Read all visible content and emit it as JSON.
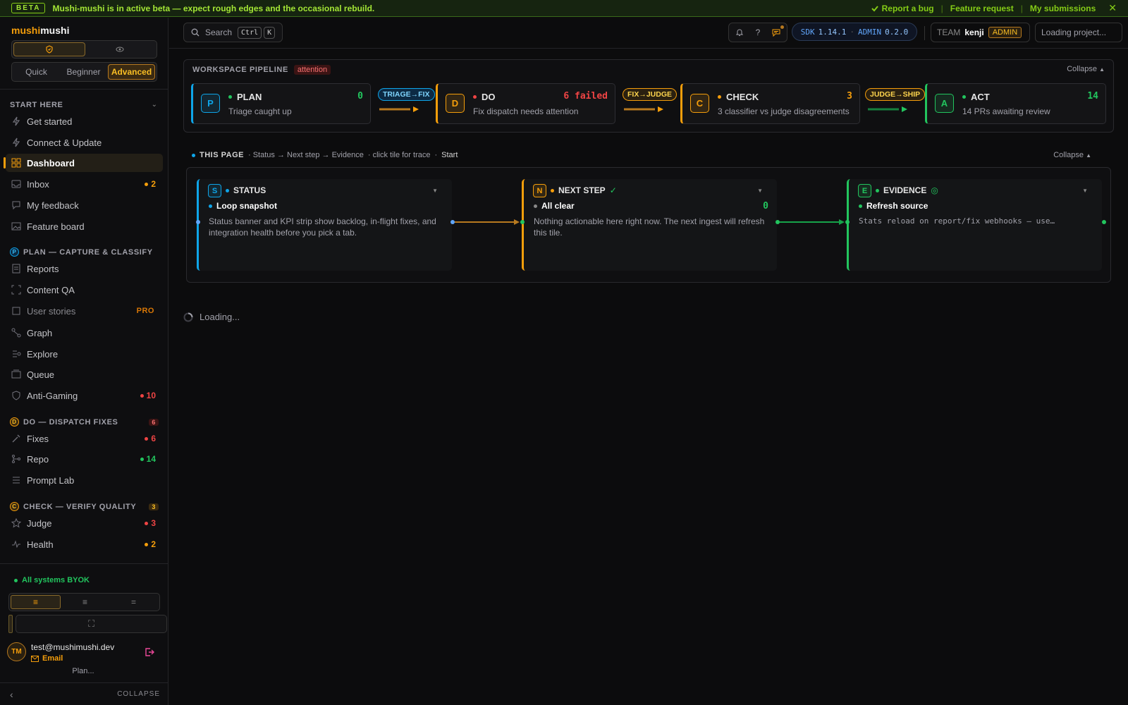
{
  "banner": {
    "tag": "BETA",
    "message": "Mushi-mushi is in active beta — expect rough edges and the occasional rebuild.",
    "links": [
      "Report a bug",
      "Feature request",
      "My submissions"
    ]
  },
  "brand": {
    "part1": "mushi",
    "part2": "mushi"
  },
  "modes": [
    "Quick",
    "Beginner",
    "Advanced"
  ],
  "modes_selected": "Advanced",
  "nav": {
    "start_here": {
      "title": "START HERE",
      "items": [
        {
          "label": "Get started",
          "icon": "bolt-icon"
        },
        {
          "label": "Connect & Update",
          "icon": "bolt-icon"
        },
        {
          "label": "Dashboard",
          "icon": "grid-icon",
          "active": true
        },
        {
          "label": "Inbox",
          "icon": "inbox-icon",
          "badge": "2",
          "badge_color": "#f59e0b"
        },
        {
          "label": "My feedback",
          "icon": "chat-icon"
        },
        {
          "label": "Feature board",
          "icon": "image-icon"
        }
      ]
    },
    "plan": {
      "title": "PLAN — CAPTURE & CLASSIFY",
      "letter": "P",
      "items": [
        {
          "label": "Reports",
          "icon": "doc-icon"
        },
        {
          "label": "Content QA",
          "icon": "scan-icon"
        },
        {
          "label": "User stories",
          "icon": "book-icon",
          "pro": "PRO"
        },
        {
          "label": "Graph",
          "icon": "graph-icon"
        },
        {
          "label": "Explore",
          "icon": "explore-icon"
        },
        {
          "label": "Queue",
          "icon": "queue-icon"
        },
        {
          "label": "Anti-Gaming",
          "icon": "shield-icon",
          "badge": "10",
          "badge_color": "#ef4444"
        }
      ]
    },
    "do": {
      "title": "DO — DISPATCH FIXES",
      "letter": "D",
      "count": "6",
      "items": [
        {
          "label": "Fixes",
          "icon": "wrench-icon",
          "badge": "6",
          "badge_color": "#ef4444"
        },
        {
          "label": "Repo",
          "icon": "branch-icon",
          "badge": "14",
          "badge_color": "#22c55e"
        },
        {
          "label": "Prompt Lab",
          "icon": "sliders-icon"
        }
      ]
    },
    "check": {
      "title": "CHECK — VERIFY QUALITY",
      "letter": "C",
      "count": "3",
      "items": [
        {
          "label": "Judge",
          "icon": "star-icon",
          "badge": "3",
          "badge_color": "#ef4444"
        },
        {
          "label": "Health",
          "icon": "pulse-icon",
          "badge": "2",
          "badge_color": "#f59e0b"
        }
      ]
    }
  },
  "system_status": "All systems BYOK",
  "user": {
    "initials": "TM",
    "email": "test@mushimushi.dev",
    "auth": "Email",
    "plan": "Plan..."
  },
  "sidebar_collapse": "COLLAPSE",
  "topbar": {
    "search_label": "Search",
    "kbd": [
      "Ctrl",
      "K"
    ],
    "help_glyph": "?",
    "sdk_label": "SDK",
    "sdk_version": "1.14.1",
    "admin_label": "ADMIN",
    "admin_version": "0.2.0",
    "team_label": "TEAM",
    "team_name": "kenji",
    "team_role": "ADMIN",
    "project": "Loading project..."
  },
  "pipeline": {
    "title": "WORKSPACE PIPELINE",
    "status": "attention",
    "collapse": "Collapse",
    "stages": [
      {
        "letter": "P",
        "name": "PLAN",
        "sub": "Triage caught up",
        "count": "0",
        "color": "#0ea5e9",
        "dot": "#22c55e",
        "count_color": "#22c55e"
      },
      {
        "letter": "D",
        "name": "DO",
        "sub": "Fix dispatch needs attention",
        "count": "6 failed",
        "color": "#f59e0b",
        "dot": "#ef4444",
        "count_color": "#ef4444"
      },
      {
        "letter": "C",
        "name": "CHECK",
        "sub": "3 classifier vs judge disagreements",
        "count": "3",
        "color": "#f59e0b",
        "dot": "#f59e0b",
        "count_color": "#f59e0b"
      },
      {
        "letter": "A",
        "name": "ACT",
        "sub": "14 PRs awaiting review",
        "count": "14",
        "color": "#22c55e",
        "dot": "#22c55e",
        "count_color": "#22c55e"
      }
    ],
    "handoffs": [
      "TRIAGE→FIX",
      "FIX→JUDGE",
      "JUDGE→SHIP"
    ]
  },
  "this_page": {
    "title": "THIS PAGE",
    "flow": "· Status → Next step → Evidence",
    "hint": "· click tile for trace",
    "sep": "·",
    "start": "Start",
    "collapse": "Collapse",
    "lanes": [
      {
        "letter": "S",
        "name": "STATUS",
        "mark": "",
        "head": "Loop snapshot",
        "body": "Status banner and KPI strip show backlog, in-flight fixes, and integration health before you pick a tab.",
        "count": "",
        "color": "#0ea5e9",
        "head_dot": "#0ea5e9"
      },
      {
        "letter": "N",
        "name": "NEXT STEP",
        "mark": "✓",
        "head": "All clear",
        "body": "Nothing actionable here right now. The next ingest will refresh this tile.",
        "count": "0",
        "color": "#f59e0b",
        "head_dot": "#888888"
      },
      {
        "letter": "E",
        "name": "EVIDENCE",
        "mark": "◎",
        "head": "Refresh source",
        "body": "Stats reload on report/fix webhooks — use…",
        "count": "",
        "color": "#22c55e",
        "head_dot": "#22c55e"
      }
    ]
  },
  "loading": "Loading..."
}
